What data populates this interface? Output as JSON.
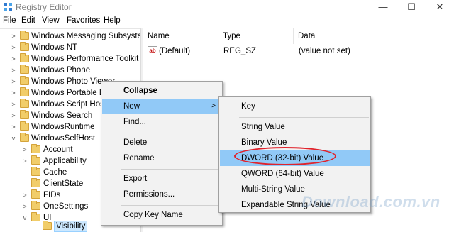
{
  "window": {
    "title": "Registry Editor",
    "controls": {
      "minimize": "—",
      "maximize": "☐",
      "close": "✕"
    },
    "icon": "registry-editor-icon"
  },
  "menubar": [
    "File",
    "Edit",
    "View",
    "Favorites",
    "Help"
  ],
  "tree": {
    "items": [
      {
        "label": "Windows Messaging Subsyste",
        "level": 1,
        "arrow": ">"
      },
      {
        "label": "Windows NT",
        "level": 1,
        "arrow": ">"
      },
      {
        "label": "Windows Performance Toolkit",
        "level": 1,
        "arrow": ">"
      },
      {
        "label": "Windows Phone",
        "level": 1,
        "arrow": ">"
      },
      {
        "label": "Windows Photo Viewer",
        "level": 1,
        "arrow": ">"
      },
      {
        "label": "Windows Portable Devices",
        "level": 1,
        "arrow": ">"
      },
      {
        "label": "Windows Script Host",
        "level": 1,
        "arrow": ">"
      },
      {
        "label": "Windows Search",
        "level": 1,
        "arrow": ">"
      },
      {
        "label": "WindowsRuntime",
        "level": 1,
        "arrow": ">"
      },
      {
        "label": "WindowsSelfHost",
        "level": 1,
        "arrow": "v"
      },
      {
        "label": "Account",
        "level": 2,
        "arrow": ">"
      },
      {
        "label": "Applicability",
        "level": 2,
        "arrow": ">"
      },
      {
        "label": "Cache",
        "level": 2,
        "arrow": ""
      },
      {
        "label": "ClientState",
        "level": 2,
        "arrow": ""
      },
      {
        "label": "FIDs",
        "level": 2,
        "arrow": ">"
      },
      {
        "label": "OneSettings",
        "level": 2,
        "arrow": ">"
      },
      {
        "label": "UI",
        "level": 2,
        "arrow": "v"
      },
      {
        "label": "Visibility",
        "level": 3,
        "arrow": "",
        "selected": true
      }
    ]
  },
  "list": {
    "columns": [
      "Name",
      "Type",
      "Data"
    ],
    "rows": [
      {
        "icon": "ab",
        "name": "(Default)",
        "type": "REG_SZ",
        "data": "(value not set)"
      }
    ]
  },
  "context_menu": {
    "items": [
      {
        "label": "Collapse",
        "bold": true
      },
      {
        "label": "New",
        "submenu": true,
        "highlighted": true
      },
      {
        "label": "Find..."
      },
      {
        "separator": true
      },
      {
        "label": "Delete"
      },
      {
        "label": "Rename"
      },
      {
        "separator": true
      },
      {
        "label": "Export"
      },
      {
        "label": "Permissions..."
      },
      {
        "separator": true
      },
      {
        "label": "Copy Key Name"
      }
    ],
    "submenu_arrow": ">"
  },
  "new_submenu": {
    "items": [
      {
        "label": "Key"
      },
      {
        "separator": true
      },
      {
        "label": "String Value"
      },
      {
        "label": "Binary Value"
      },
      {
        "label": "DWORD (32-bit) Value",
        "highlighted": true
      },
      {
        "label": "QWORD (64-bit) Value"
      },
      {
        "label": "Multi-String Value"
      },
      {
        "label": "Expandable String Value"
      }
    ]
  },
  "watermark": "Download.com.vn",
  "colors": {
    "highlight": "#91c9f7",
    "annotation_oval": "#e0222b",
    "folder": "#f1cd6a",
    "menu_bg": "#f2f2f2"
  }
}
